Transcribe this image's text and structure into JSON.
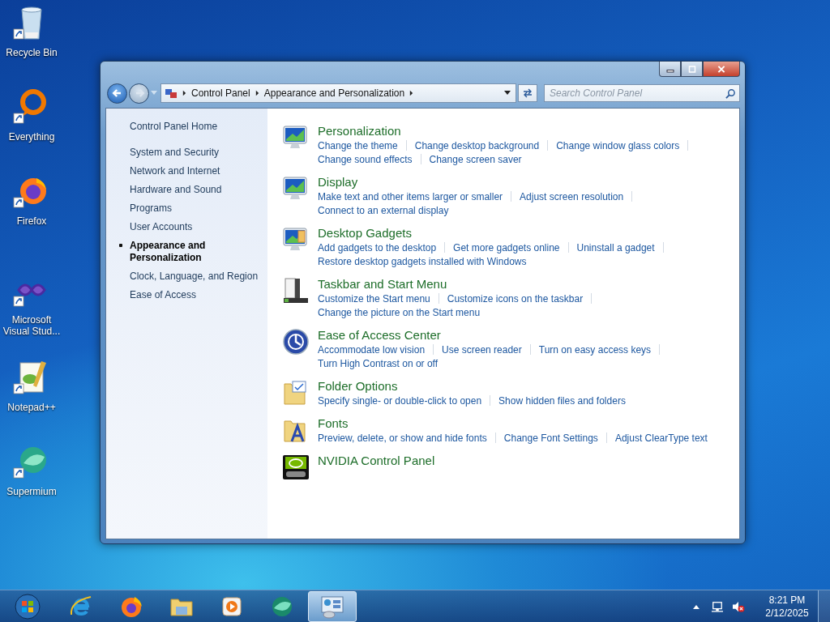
{
  "desktop_icons": [
    {
      "label": "Recycle Bin",
      "kind": "recycle"
    },
    {
      "label": "Everything",
      "kind": "ring"
    },
    {
      "label": "Firefox",
      "kind": "fox"
    },
    {
      "label": "Microsoft Visual Stud...",
      "kind": "infinity"
    },
    {
      "label": "Notepad++",
      "kind": "notepad"
    },
    {
      "label": "Supermium",
      "kind": "sphere"
    }
  ],
  "window": {
    "address_bar": {
      "breadcrumbs": [
        "Control Panel",
        "Appearance and Personalization"
      ]
    },
    "search": {
      "placeholder": "Search Control Panel"
    },
    "sidebar": {
      "home": "Control Panel Home",
      "items": [
        {
          "label": "System and Security",
          "selected": false
        },
        {
          "label": "Network and Internet",
          "selected": false
        },
        {
          "label": "Hardware and Sound",
          "selected": false
        },
        {
          "label": "Programs",
          "selected": false
        },
        {
          "label": "User Accounts",
          "selected": false
        },
        {
          "label": "Appearance and Personalization",
          "selected": true
        },
        {
          "label": "Clock, Language, and Region",
          "selected": false
        },
        {
          "label": "Ease of Access",
          "selected": false
        }
      ]
    },
    "categories": [
      {
        "title": "Personalization",
        "kind": "monitor",
        "links": [
          [
            "Change the theme",
            "Change desktop background",
            "Change window glass colors"
          ],
          [
            "Change sound effects",
            "Change screen saver"
          ]
        ]
      },
      {
        "title": "Display",
        "kind": "monitor",
        "links": [
          [
            "Make text and other items larger or smaller",
            "Adjust screen resolution"
          ],
          [
            "Connect to an external display"
          ]
        ]
      },
      {
        "title": "Desktop Gadgets",
        "kind": "gadgets",
        "links": [
          [
            "Add gadgets to the desktop",
            "Get more gadgets online",
            "Uninstall a gadget"
          ],
          [
            "Restore desktop gadgets installed with Windows"
          ]
        ]
      },
      {
        "title": "Taskbar and Start Menu",
        "kind": "taskbar",
        "links": [
          [
            "Customize the Start menu",
            "Customize icons on the taskbar"
          ],
          [
            "Change the picture on the Start menu"
          ]
        ]
      },
      {
        "title": "Ease of Access Center",
        "kind": "access",
        "links": [
          [
            "Accommodate low vision",
            "Use screen reader",
            "Turn on easy access keys"
          ],
          [
            "Turn High Contrast on or off"
          ]
        ]
      },
      {
        "title": "Folder Options",
        "kind": "folder",
        "links": [
          [
            "Specify single- or double-click to open",
            "Show hidden files and folders"
          ]
        ]
      },
      {
        "title": "Fonts",
        "kind": "fonts",
        "links": [
          [
            "Preview, delete, or show and hide fonts",
            "Change Font Settings",
            "Adjust ClearType text"
          ]
        ]
      },
      {
        "title": "NVIDIA Control Panel",
        "kind": "nvidia"
      }
    ]
  },
  "taskbar": {
    "items": [
      {
        "kind": "start",
        "selected": false
      },
      {
        "kind": "ie",
        "selected": false
      },
      {
        "kind": "fox",
        "selected": false
      },
      {
        "kind": "explorer",
        "selected": false
      },
      {
        "kind": "media",
        "selected": false
      },
      {
        "kind": "sphere",
        "selected": false
      },
      {
        "kind": "panel",
        "selected": true
      }
    ],
    "time": "8:21 PM",
    "date": "2/12/2025"
  }
}
